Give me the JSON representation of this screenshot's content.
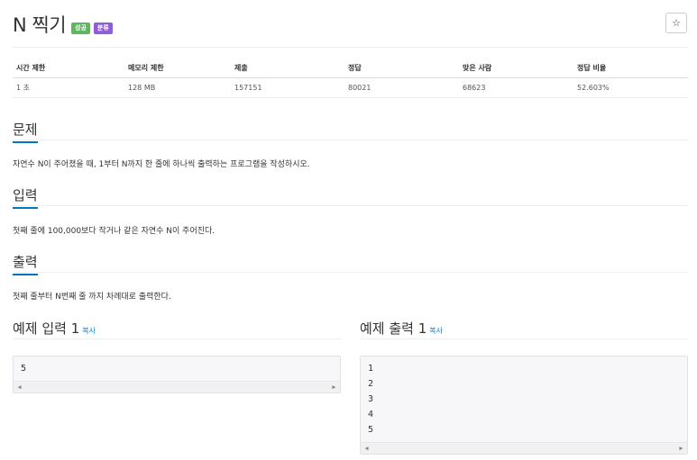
{
  "problem": {
    "title": "N 찍기",
    "badges": [
      "성공",
      "분류"
    ],
    "star_label": "☆"
  },
  "info_table": {
    "headers": [
      "시간 제한",
      "메모리 제한",
      "제출",
      "정답",
      "맞은 사람",
      "정답 비율"
    ],
    "row": [
      "1 초",
      "128 MB",
      "157151",
      "80021",
      "68623",
      "52.603%"
    ]
  },
  "sections": {
    "problem": {
      "heading": "문제",
      "text": "자연수 N이 주어졌을 때, 1부터 N까지 한 줄에 하나씩 출력하는 프로그램을 작성하시오."
    },
    "input": {
      "heading": "입력",
      "text": "첫째 줄에 100,000보다 작거나 같은 자연수 N이 주어진다."
    },
    "output": {
      "heading": "출력",
      "text": "첫째 줄부터 N번째 줄 까지 차례대로 출력한다."
    }
  },
  "samples": {
    "input": {
      "heading": "예제 입력 1",
      "copy": "복사",
      "lines": [
        "5"
      ]
    },
    "output": {
      "heading": "예제 출력 1",
      "copy": "복사",
      "lines": [
        "1",
        "2",
        "3",
        "4",
        "5"
      ]
    }
  },
  "colors": {
    "accent": "#0076c0",
    "success": "#5cb85c",
    "tag": "#8e5ed6"
  }
}
